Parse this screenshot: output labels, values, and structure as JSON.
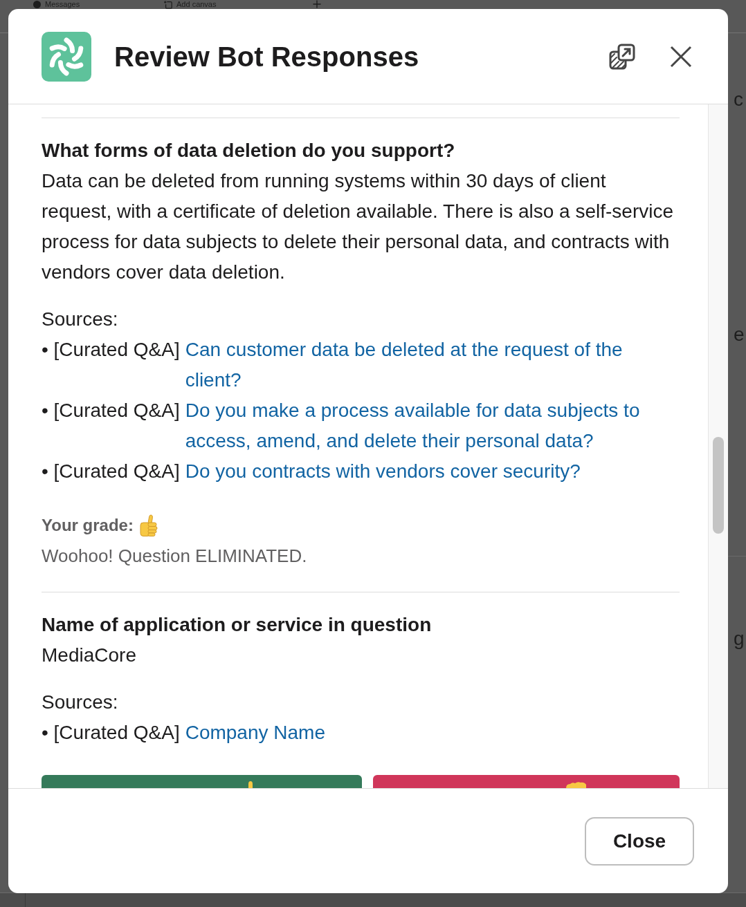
{
  "backdrop": {
    "tabs": [
      {
        "label": "Messages"
      },
      {
        "label": "Add canvas"
      }
    ],
    "edge_text": [
      "c",
      "e",
      "g"
    ]
  },
  "dialog": {
    "title": "Review Bot Responses",
    "close_button": "Close"
  },
  "responses": [
    {
      "question": "What forms of data deletion do you support?",
      "answer": "Data can be deleted from running systems within 30 days of client request, with a certificate of deletion available. There is also a self-service process for data subjects to delete their personal data, and contracts with vendors cover data deletion.",
      "sources_label": "Sources:",
      "sources": [
        {
          "prefix": "• [Curated Q&A]",
          "link": "Can customer data be deleted at the request of the client?"
        },
        {
          "prefix": "• [Curated Q&A]",
          "link": "Do you make a process available for data subjects to access, amend, and delete their personal data?"
        },
        {
          "prefix": "• [Curated Q&A]",
          "link": "Do you contracts with vendors cover security?"
        }
      ],
      "grade": {
        "label": "Your grade:",
        "approved": true,
        "feedback": "Woohoo! Question ELIMINATED."
      }
    },
    {
      "question": "Name of application or service in question",
      "answer": "MediaCore",
      "sources_label": "Sources:",
      "sources": [
        {
          "prefix": "• [Curated Q&A]",
          "link": "Company Name"
        }
      ],
      "grade_buttons": [
        {
          "kind": "up",
          "color": "#357a5a"
        },
        {
          "kind": "down",
          "color": "#d0365a"
        }
      ]
    }
  ]
}
